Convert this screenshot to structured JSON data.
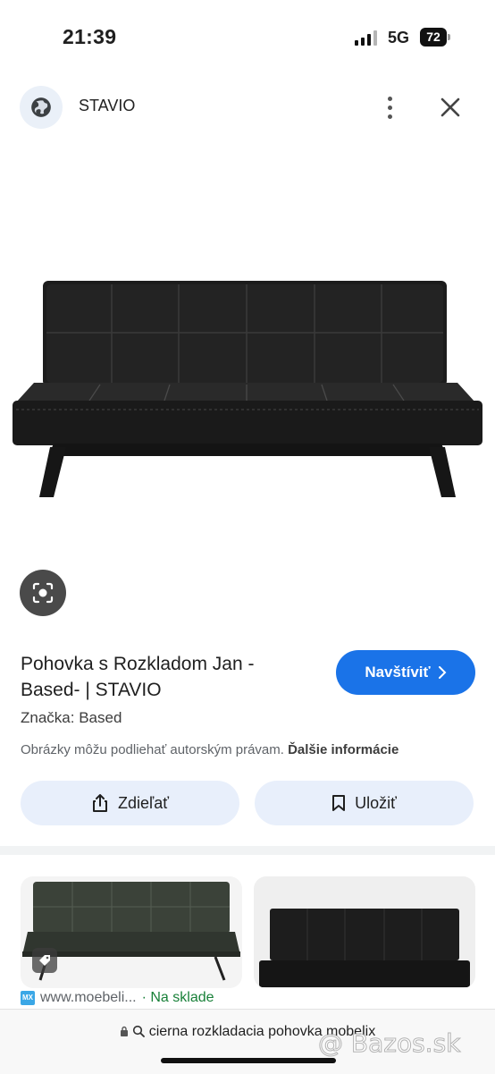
{
  "status_bar": {
    "time": "21:39",
    "network": "5G",
    "battery": "72"
  },
  "header": {
    "site_name": "STAVIO",
    "icons": [
      "globe-icon",
      "more-vert-icon",
      "close-icon"
    ]
  },
  "product": {
    "title": "Pohovka s Rozkladom Jan - Based- | STAVIO",
    "visit_label": "Navštíviť",
    "brand_line": "Značka: Based",
    "copyright_text": "Obrázky môžu podliehať autorským právam.",
    "more_info_link": "Ďalšie informácie"
  },
  "actions": {
    "share_label": "Zdieľať",
    "save_label": "Uložiť"
  },
  "related": [
    {
      "source": "www.moebeli...",
      "badge": "MX",
      "stock": "· Na sklade"
    },
    {
      "source": "",
      "badge": "",
      "stock": ""
    }
  ],
  "bottom_bar": {
    "query": "cierna rozkladacia pohovka mobelix",
    "watermark": "@ Bazos.sk"
  },
  "colors": {
    "accent": "#1a73e8",
    "pill_bg": "#e8effb",
    "in_stock": "#188038"
  }
}
